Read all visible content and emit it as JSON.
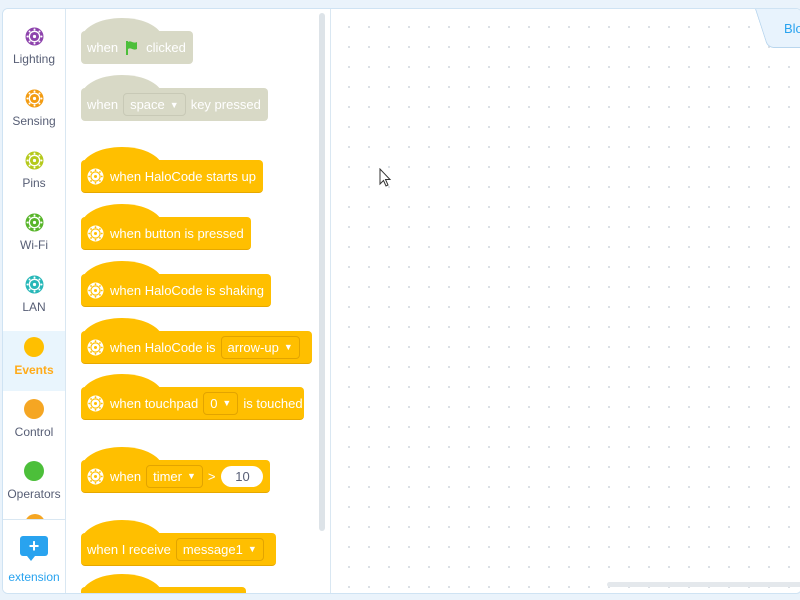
{
  "categories": [
    {
      "label": "Lighting",
      "color": "#8e44ad",
      "active": false
    },
    {
      "label": "Sensing",
      "color": "#f39c12",
      "active": false
    },
    {
      "label": "Pins",
      "color": "#b5c91c",
      "active": false
    },
    {
      "label": "Wi-Fi",
      "color": "#58b52a",
      "active": false
    },
    {
      "label": "LAN",
      "color": "#27b7b8",
      "active": false
    },
    {
      "label": "Events",
      "color": "#ffbf00",
      "active": true
    },
    {
      "label": "Control",
      "color": "#f5a623",
      "active": false
    },
    {
      "label": "Operators",
      "color": "#4cbf3a",
      "active": false
    }
  ],
  "extension": {
    "label": "extension",
    "icon": "plus-icon"
  },
  "blocks": {
    "flag_clicked": {
      "when": "when",
      "clicked": "clicked",
      "icon": "green-flag-icon"
    },
    "key_pressed": {
      "when": "when",
      "key": "space",
      "suffix": "key pressed"
    },
    "starts_up": "when HaloCode starts up",
    "button_pressed": "when button is pressed",
    "shaking": "when HaloCode is shaking",
    "halocode_is": {
      "text": "when HaloCode is",
      "option": "arrow-up"
    },
    "touchpad": {
      "text": "when touchpad",
      "option": "0",
      "suffix": "is touched"
    },
    "timer": {
      "when": "when",
      "option": "timer",
      "op": ">",
      "value": "10"
    },
    "receive": {
      "text": "when I receive",
      "option": "message1"
    }
  },
  "workspace": {
    "tab_label": "Blo"
  },
  "colors": {
    "events": "#ffbf00",
    "disabled": "#d8d9c6",
    "accent": "#29a3ef"
  }
}
